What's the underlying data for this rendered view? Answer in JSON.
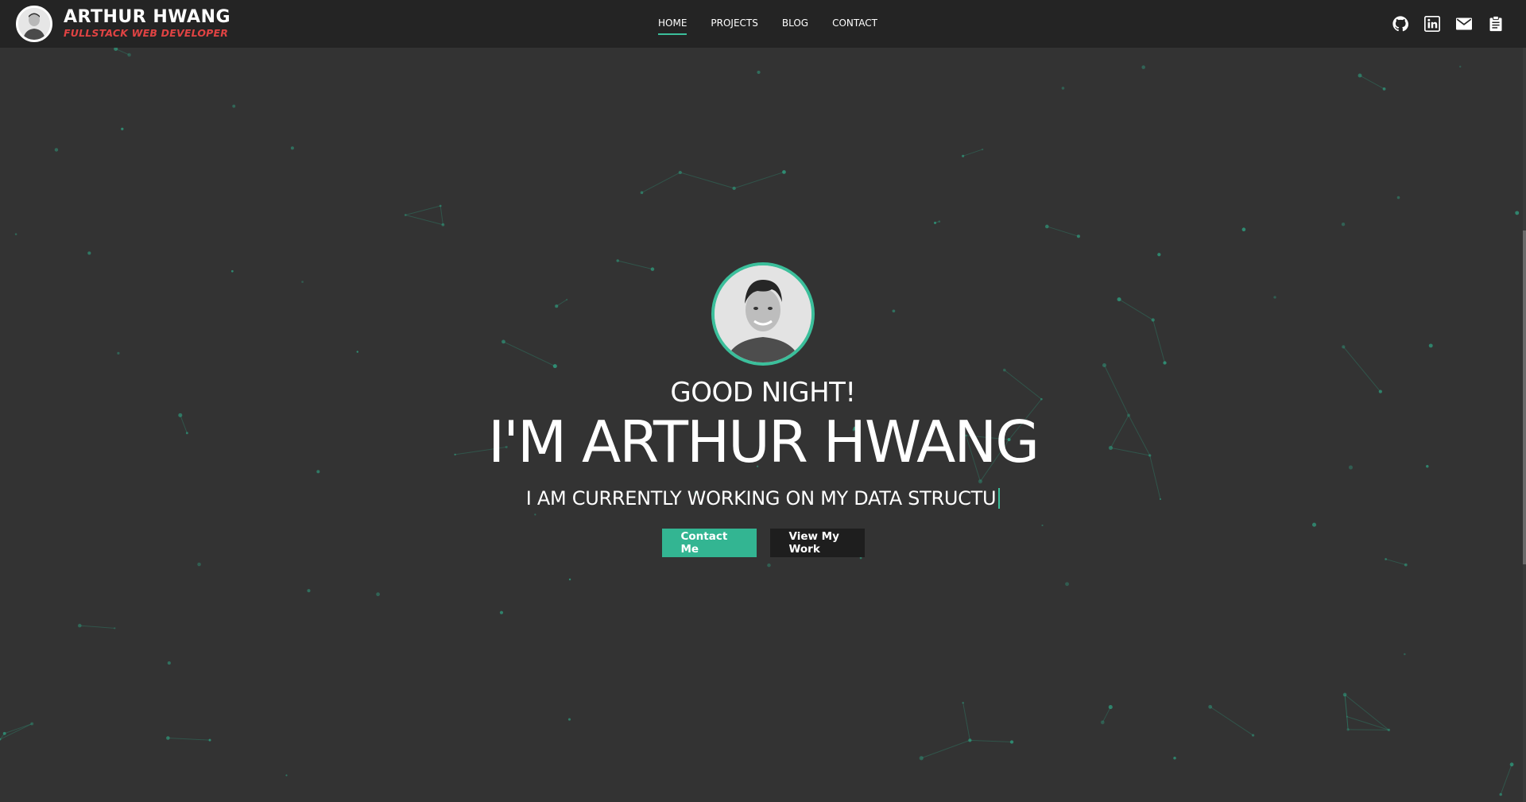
{
  "header": {
    "brand_name": "ARTHUR HWANG",
    "brand_tagline": "FULLSTACK WEB DEVELOPER",
    "nav": [
      {
        "label": "HOME",
        "active": true
      },
      {
        "label": "PROJECTS",
        "active": false
      },
      {
        "label": "BLOG",
        "active": false
      },
      {
        "label": "CONTACT",
        "active": false
      }
    ],
    "social_icons": [
      "github-icon",
      "linkedin-icon",
      "mail-icon",
      "resume-clipboard-icon"
    ]
  },
  "hero": {
    "greeting": "GOOD NIGHT!",
    "name_line": "I'M ARTHUR HWANG",
    "typed_text": "I AM CURRENTLY WORKING ON MY DATA STRUCTU",
    "buttons": {
      "contact": "Contact Me",
      "work": "View My Work"
    }
  },
  "colors": {
    "accent": "#3bbf9b",
    "background": "#333333",
    "header": "#242424",
    "tagline": "#e04343",
    "dark_button": "#1e1e1e"
  }
}
